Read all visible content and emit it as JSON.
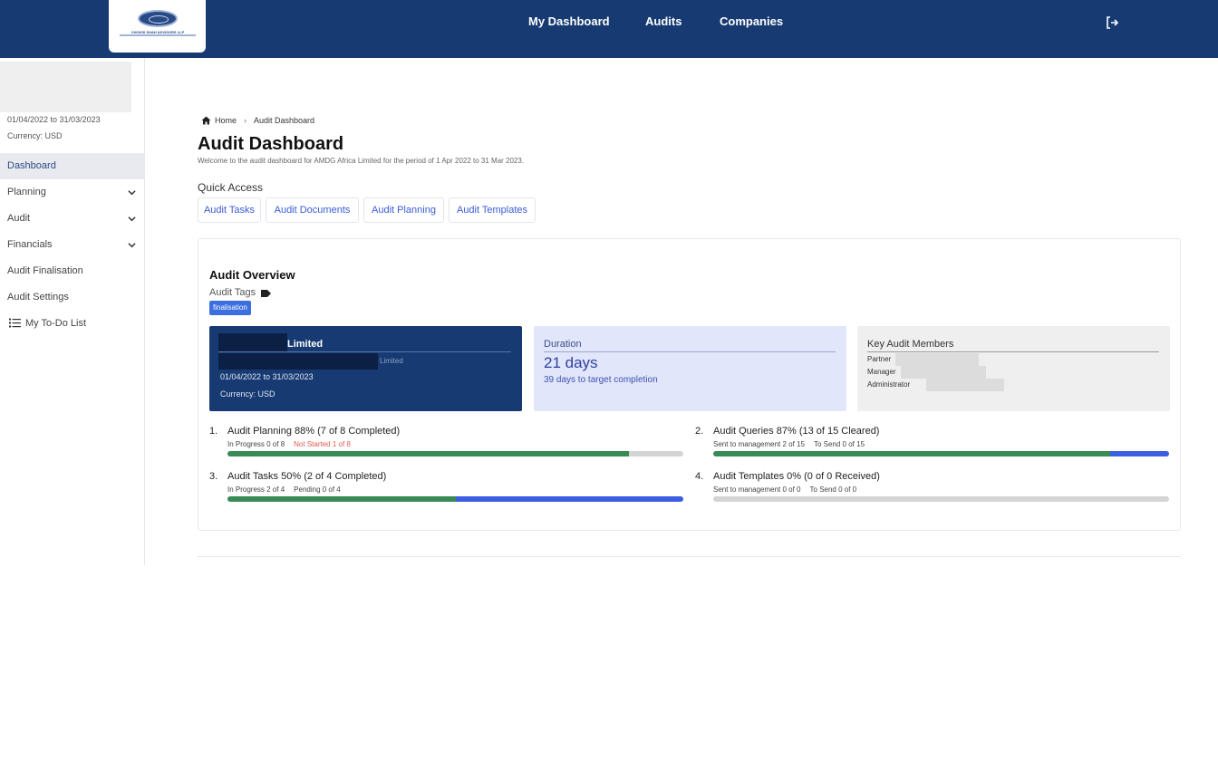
{
  "app": {
    "logo_text": "CHOKSI SHAH ADVISORS LLP",
    "nav": [
      "My Dashboard",
      "Audits",
      "Companies"
    ]
  },
  "sidebar": {
    "period": "01/04/2022 to 31/03/2023",
    "currency": "Currency: USD",
    "items": [
      {
        "label": "Dashboard",
        "active": true,
        "expandable": false
      },
      {
        "label": "Planning",
        "active": false,
        "expandable": true
      },
      {
        "label": "Audit",
        "active": false,
        "expandable": true
      },
      {
        "label": "Financials",
        "active": false,
        "expandable": true
      },
      {
        "label": "Audit Finalisation",
        "active": false,
        "expandable": false
      },
      {
        "label": "Audit Settings",
        "active": false,
        "expandable": false
      },
      {
        "label": "My To-Do List",
        "active": false,
        "expandable": false,
        "icon": "list-icon"
      }
    ]
  },
  "breadcrumb": {
    "home": "Home",
    "current": "Audit Dashboard"
  },
  "page": {
    "title": "Audit Dashboard",
    "subtitle": "Welcome to the audit dashboard for AMDG Africa Limited for the period of 1 Apr 2022 to 31 Mar 2023."
  },
  "quick_access": {
    "label": "Quick Access",
    "buttons": [
      "Audit Tasks",
      "Audit Documents",
      "Audit Planning",
      "Audit Templates"
    ]
  },
  "overview": {
    "title": "Audit Overview",
    "tags_label": "Audit Tags",
    "tag": "finalisation",
    "company": {
      "name": "Limited",
      "sub": "Limited",
      "period": "01/04/2022 to 31/03/2023",
      "currency": "Currency: USD",
      "accent": "#173a72"
    },
    "duration": {
      "label": "Duration",
      "value": "21 days",
      "note": "39 days to target completion"
    },
    "members": {
      "label": "Key Audit Members",
      "roles": [
        "Partner",
        "Manager",
        "Administrator"
      ]
    },
    "progress": [
      {
        "num": "1.",
        "title": "Audit Planning",
        "percent": "88%",
        "summary": "(7 of 8 Completed)",
        "meta": [
          "In Progress 0 of 8",
          "Not Started 1 of 8"
        ],
        "meta_warn_index": 1,
        "green": 0.88,
        "blue": 0
      },
      {
        "num": "2.",
        "title": "Audit Queries",
        "percent": "87%",
        "summary": "(13 of 15 Cleared)",
        "meta": [
          "Sent to management 2 of 15",
          "To Send 0 of 15"
        ],
        "meta_warn_index": -1,
        "green": 0.87,
        "blue": 0.13
      },
      {
        "num": "3.",
        "title": "Audit Tasks",
        "percent": "50%",
        "summary": "(2 of 4 Completed)",
        "meta": [
          "In Progress 2 of 4",
          "Pending 0 of 4"
        ],
        "meta_warn_index": -1,
        "green": 0.5,
        "blue": 0.5
      },
      {
        "num": "4.",
        "title": "Audit Templates",
        "percent": "0%",
        "summary": "(0 of 0 Received)",
        "meta": [
          "Sent to management 0 of 0",
          "To Send 0 of 0"
        ],
        "meta_warn_index": -1,
        "green": 0,
        "blue": 0
      }
    ]
  },
  "colors": {
    "nav_bg": "#173a72",
    "link": "#3a5bd9",
    "progress_green": "#3a8a55",
    "progress_blue": "#3b5fe0",
    "warn": "#e05a4f"
  }
}
